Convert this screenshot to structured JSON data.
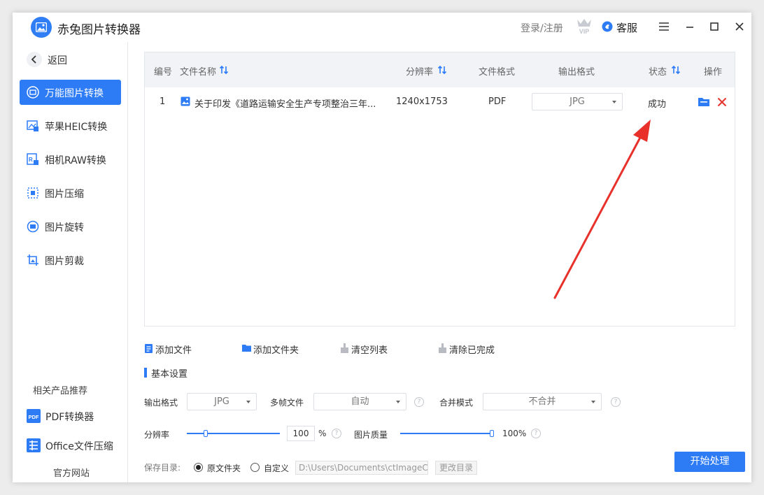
{
  "app": {
    "title": "赤兔图片转换器",
    "login": "登录/注册",
    "vip": "VIP",
    "service": "客服"
  },
  "sidebar": {
    "back": "返回",
    "items": [
      {
        "label": "万能图片转换",
        "icon": "image-convert-icon",
        "active": true
      },
      {
        "label": "苹果HEIC转换",
        "icon": "heic-icon"
      },
      {
        "label": "相机RAW转换",
        "icon": "raw-icon"
      },
      {
        "label": "图片压缩",
        "icon": "compress-icon"
      },
      {
        "label": "图片旋转",
        "icon": "rotate-icon"
      },
      {
        "label": "图片剪裁",
        "icon": "crop-icon"
      }
    ],
    "related_title": "相关产品推荐",
    "related": [
      {
        "label": "PDF转换器",
        "icon": "pdf-icon"
      },
      {
        "label": "Office文件压缩",
        "icon": "office-icon"
      }
    ],
    "website": "官方网站"
  },
  "table": {
    "headers": {
      "index": "编号",
      "name": "文件名称",
      "resolution": "分辨率",
      "format": "文件格式",
      "output": "输出格式",
      "status": "状态",
      "action": "操作"
    },
    "rows": [
      {
        "index": "1",
        "name": "关于印发《道路运输安全生产专项整治三年...",
        "resolution": "1240x1753",
        "format": "PDF",
        "output": "JPG",
        "status": "成功"
      }
    ]
  },
  "toolbar": {
    "add_file": "添加文件",
    "add_folder": "添加文件夹",
    "clear_list": "清空列表",
    "clear_done": "清除已完成"
  },
  "settings": {
    "title": "基本设置",
    "output_format_label": "输出格式",
    "output_format": "JPG",
    "multiframe_label": "多帧文件",
    "multiframe": "自动",
    "merge_label": "合并模式",
    "merge": "不合并",
    "resolution_label": "分辨率",
    "resolution_value": "100",
    "resolution_unit": "%",
    "resolution_pct": 0.2,
    "quality_label": "图片质量",
    "quality_value": "100%",
    "quality_pct": 1.0,
    "help": "?"
  },
  "save": {
    "label": "保存目录:",
    "opt_original": "原文件夹",
    "opt_custom": "自定义",
    "path": "D:\\Users\\Documents\\ctImageCc",
    "change": "更改目录"
  },
  "start_button": "开始处理",
  "colors": {
    "accent": "#2d7cf6",
    "delete": "#e53935",
    "arrow": "#e8312b"
  }
}
